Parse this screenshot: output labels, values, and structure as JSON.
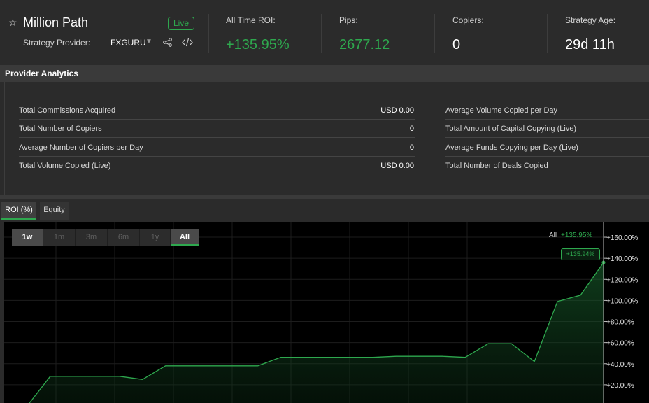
{
  "header": {
    "strategy_name": "Million Path",
    "status_badge": "Live",
    "provider_label": "Strategy Provider:",
    "provider_name": "FXGURU",
    "stats": [
      {
        "label": "All Time ROI:",
        "value": "+135.95%"
      },
      {
        "label": "Pips:",
        "value": "2677.12"
      },
      {
        "label": "Copiers:",
        "value": "0"
      },
      {
        "label": "Strategy Age:",
        "value": "29d 11h"
      }
    ],
    "icons": {
      "favorite": "star-outline-icon",
      "dropdown": "caret-down-icon",
      "share": "share-icon",
      "embed": "code-icon"
    }
  },
  "analytics": {
    "title": "Provider Analytics",
    "left": [
      {
        "label": "Total Commissions Acquired",
        "value": "USD 0.00"
      },
      {
        "label": "Total Number of Copiers",
        "value": "0"
      },
      {
        "label": "Average Number of Copiers per Day",
        "value": "0"
      },
      {
        "label": "Total Volume Copied (Live)",
        "value": "USD 0.00"
      }
    ],
    "right": [
      {
        "label": "Average Volume Copied per Day",
        "value": ""
      },
      {
        "label": "Total Amount of Capital Copying (Live)",
        "value": ""
      },
      {
        "label": "Average Funds Copying per Day (Live)",
        "value": ""
      },
      {
        "label": "Total Number of Deals Copied",
        "value": ""
      }
    ]
  },
  "tabs": [
    {
      "label": "ROI (%)",
      "active": true
    },
    {
      "label": "Equity",
      "active": false
    }
  ],
  "chart_data": {
    "type": "area",
    "range_buttons": [
      "1w",
      "1m",
      "3m",
      "6m",
      "1y",
      "All"
    ],
    "selected_range": "All",
    "legend": {
      "name": "All",
      "value": "+135.95%"
    },
    "last_value_label": "+135.94%",
    "y_ticks": [
      "+160.00%",
      "+140.00%",
      "+120.00%",
      "+100.00%",
      "+80.00%",
      "+60.00%",
      "+40.00%",
      "+20.00%"
    ],
    "y_tick_values": [
      160,
      140,
      120,
      100,
      80,
      60,
      40,
      20
    ],
    "ylim": [
      0,
      170
    ],
    "grid": true,
    "line_color": "#2ea84e",
    "values": [
      -5,
      0,
      28,
      28,
      28,
      28,
      25,
      38,
      38,
      38,
      38,
      38,
      46,
      46,
      46,
      46,
      46,
      47,
      47,
      47,
      46,
      59,
      59,
      42,
      99,
      105,
      136
    ]
  },
  "colors": {
    "accent": "#2ea84e",
    "background": "#2b2b2b",
    "chart_bg": "#000000"
  }
}
